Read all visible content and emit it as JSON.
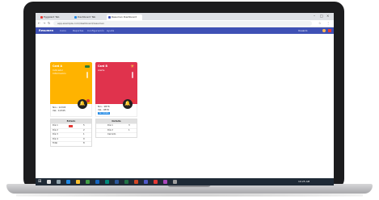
{
  "browser": {
    "tabs": [
      {
        "label": "Eggplant Tab"
      },
      {
        "label": "Dashboard Tab"
      },
      {
        "label": "Resumen Dashboard"
      }
    ],
    "address": "app.example.com/dashboard/resumen",
    "controls": {
      "minimize": "–",
      "maximize": "□",
      "close": "×"
    }
  },
  "app": {
    "brand": "Resumen",
    "menu": [
      "Inicio",
      "Reportes",
      "Configuración",
      "Ayuda"
    ],
    "user": "Usuario",
    "nav_color": "#3f51b5"
  },
  "cards": [
    {
      "color": "#ffb300",
      "title": "Card A",
      "subtitle1": "Indicador",
      "subtitle2": "Información",
      "info_lines": [
        "Nro.: 12345",
        "Val.: 12345"
      ],
      "bell_icon": "bell-icon",
      "table": {
        "header": "Estado",
        "rows": [
          {
            "label": "Día 1",
            "value": "5"
          },
          {
            "label": "Día 2",
            "value": "2"
          },
          {
            "label": "Día 3",
            "value": "1"
          },
          {
            "label": "Día 4",
            "value": "0"
          },
          {
            "label": "Total",
            "value": "8"
          }
        ]
      }
    },
    {
      "color": "#e0334d",
      "title": "Card B",
      "subtitle1": "Alerta",
      "info_lines": [
        "Nro.: 9876",
        "Val.: 9876"
      ],
      "badge": "Ver detalle",
      "bell_icon": "bell-icon",
      "table": {
        "header": "Detalle",
        "rows": [
          {
            "label": "Día 1",
            "value": "3"
          },
          {
            "label": "Día 2",
            "value": "1"
          },
          {
            "label": "Cerrado",
            "value": ""
          }
        ]
      }
    }
  ],
  "taskbar": {
    "start_icon": "windows-icon",
    "clock": "10:25 AM",
    "icons": [
      "search-icon",
      "task-view-icon",
      "edge-icon",
      "explorer-icon",
      "chrome-icon",
      "mail-icon",
      "store-icon",
      "word-icon",
      "excel-icon",
      "powerpoint-icon",
      "teams-icon",
      "media-icon",
      "photos-icon",
      "settings-icon"
    ]
  }
}
